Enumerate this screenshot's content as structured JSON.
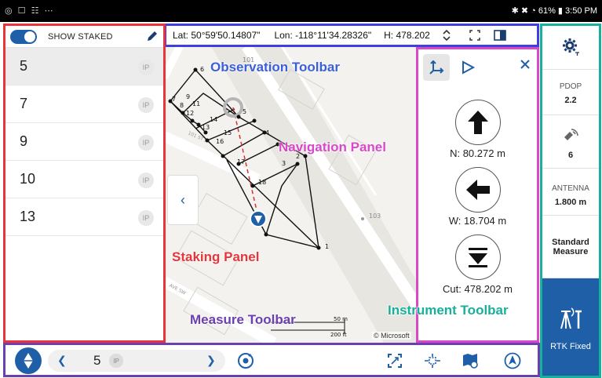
{
  "status_bar": {
    "left_icons": "◎ ☐ ☷ ⋯",
    "right_text": "✱ ✖ ◔ 61% ▮ 3:50 PM"
  },
  "observation_toolbar": {
    "lat": "Lat: 50°59'50.14807\"",
    "lon": "Lon: -118°11'34.28326\"",
    "height": "H: 478.202"
  },
  "staking_panel": {
    "toggle_label": "SHOW STAKED",
    "toggle_on": true,
    "items": [
      {
        "label": "5",
        "badge": "IP",
        "selected": true
      },
      {
        "label": "7",
        "badge": "IP",
        "selected": false
      },
      {
        "label": "9",
        "badge": "IP",
        "selected": false
      },
      {
        "label": "10",
        "badge": "IP",
        "selected": false
      },
      {
        "label": "13",
        "badge": "IP",
        "selected": false
      }
    ]
  },
  "map": {
    "parcel_labels": [
      "6",
      "9",
      "7",
      "8",
      "11",
      "12",
      "14",
      "5",
      "13",
      "15",
      "16",
      "4",
      "2",
      "3",
      "17",
      "18",
      "1"
    ],
    "lot_numbers": [
      "101",
      "103"
    ],
    "street_labels": [
      "101 ST S",
      "AVE SW"
    ],
    "scale_m": "50 m",
    "scale_ft": "200 ft",
    "copyright": "© Microsoft"
  },
  "navigation_panel": {
    "north": "N: 80.272 m",
    "west": "W: 18.704 m",
    "cut": "Cut: 478.202 m"
  },
  "instrument_toolbar": {
    "pdop_label": "PDOP",
    "pdop_value": "2.2",
    "satellites_value": "6",
    "antenna_label": "ANTENNA",
    "antenna_value": "1.800 m",
    "measure_mode_line1": "Standard",
    "measure_mode_line2": "Measure",
    "rtk_status": "RTK Fixed"
  },
  "measure_toolbar": {
    "point_value": "5",
    "point_badge": "IP"
  },
  "annotations": {
    "observation": "Observation Toolbar",
    "navigation": "Navigation Panel",
    "staking": "Staking Panel",
    "measure": "Measure Toolbar",
    "instrument": "Instrument Toolbar"
  },
  "colors": {
    "staking_border": "#e8353a",
    "observation_border": "#3f3fe0",
    "navigation_border": "#d848c8",
    "instrument_border": "#18b09a",
    "measure_border": "#6a3fb0",
    "accent": "#1f5fa8"
  }
}
